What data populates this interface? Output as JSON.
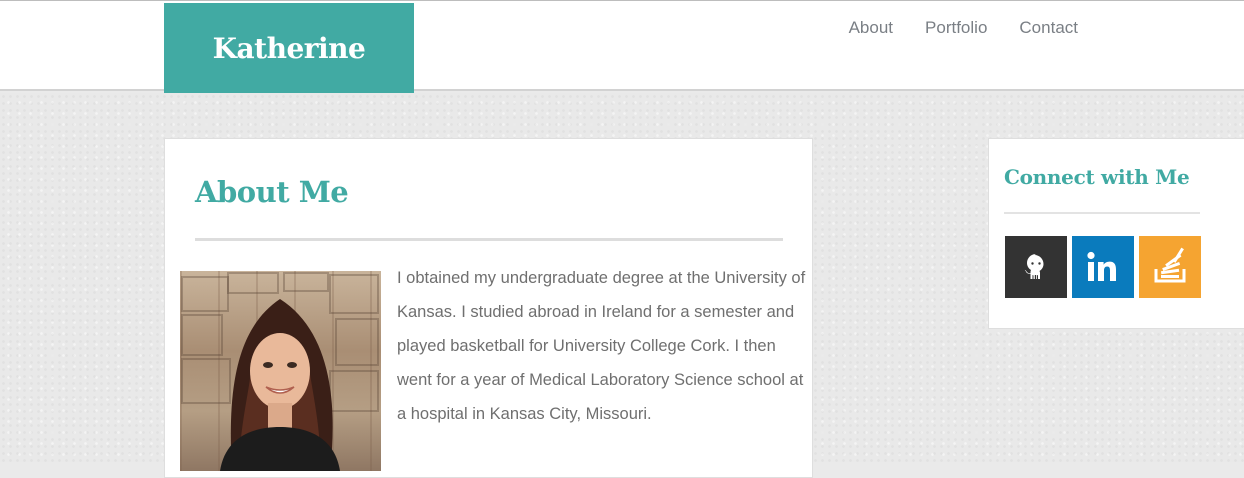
{
  "header": {
    "brand": "Katherine",
    "nav": [
      {
        "label": "About"
      },
      {
        "label": "Portfolio"
      },
      {
        "label": "Contact"
      }
    ]
  },
  "about": {
    "title": "About Me",
    "photo_icon": "profile-photo",
    "bio": "I obtained my undergraduate degree at the University of Kansas. I studied abroad in Ireland for a semester and played basketball for University College Cork. I then went for a year of Medical Laboratory Science school at a hospital in Kansas City, Missouri."
  },
  "connect": {
    "title": "Connect with Me",
    "links": [
      {
        "name": "github",
        "icon": "github-icon",
        "color": "#333333"
      },
      {
        "name": "linkedin",
        "icon": "linkedin-icon",
        "color": "#0a7bbd"
      },
      {
        "name": "stackoverflow",
        "icon": "stackoverflow-icon",
        "color": "#f5a431"
      }
    ]
  },
  "colors": {
    "accent": "#41aaa3",
    "text": "#6f6f6f",
    "nav": "#7a7f85"
  }
}
